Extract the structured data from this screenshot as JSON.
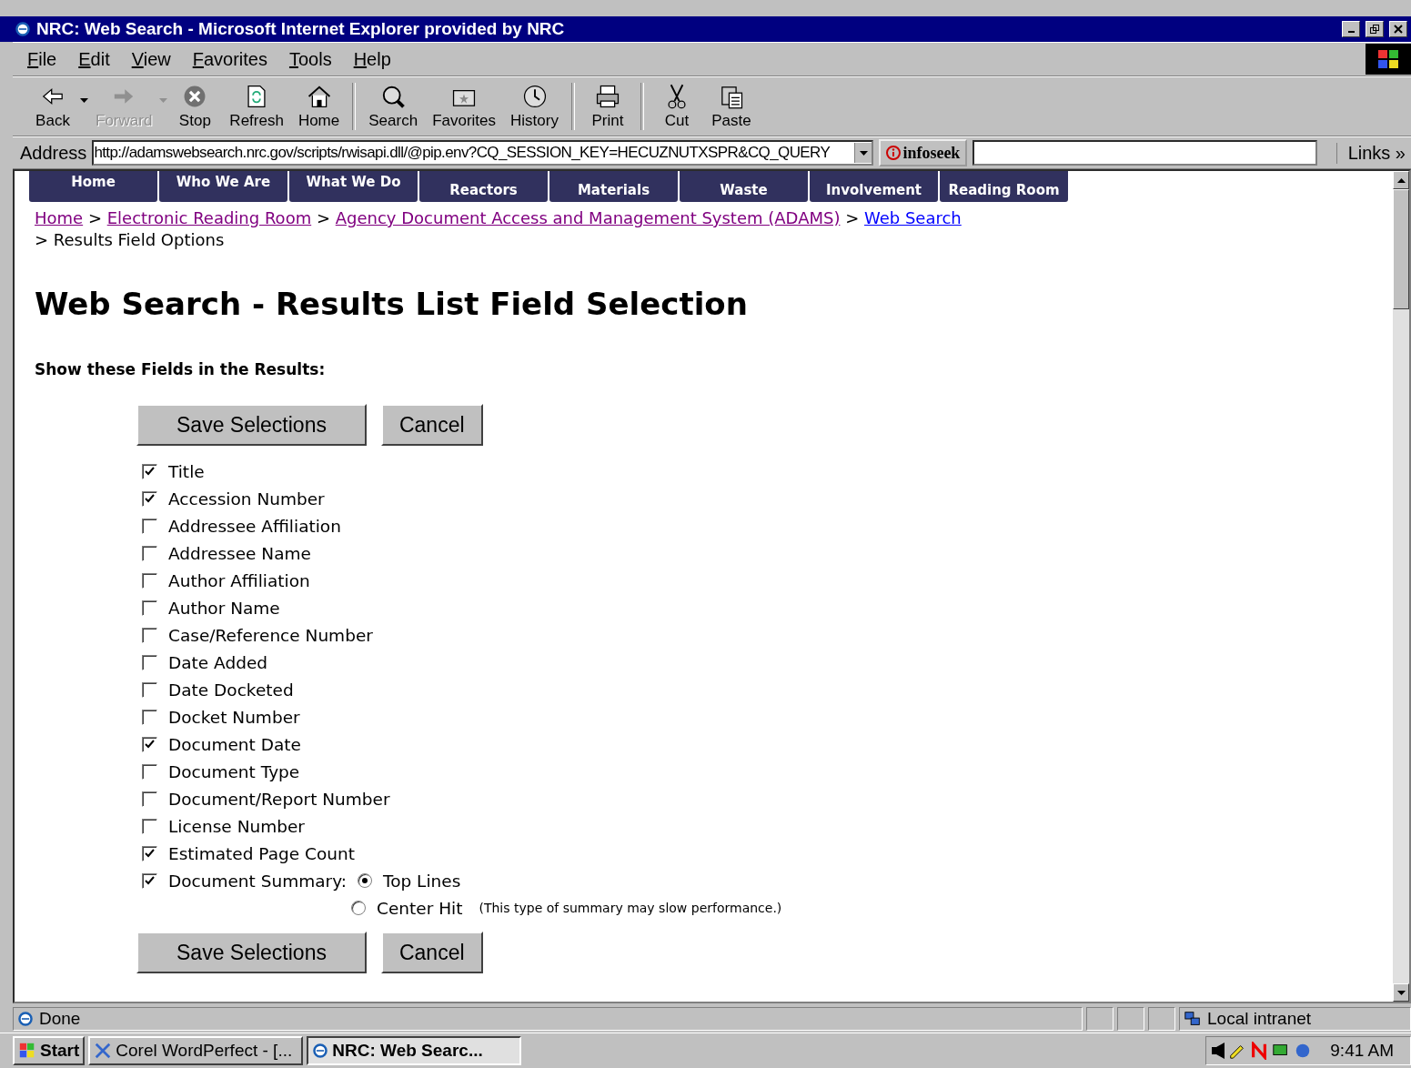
{
  "window": {
    "title": "NRC: Web Search - Microsoft Internet Explorer provided by NRC"
  },
  "menu": [
    {
      "label": "File"
    },
    {
      "label": "Edit"
    },
    {
      "label": "View"
    },
    {
      "label": "Favorites"
    },
    {
      "label": "Tools"
    },
    {
      "label": "Help"
    }
  ],
  "toolbar": [
    {
      "label": "Back",
      "kind": "back",
      "disabled": false,
      "dropdown": true,
      "separator_before": false
    },
    {
      "label": "Forward",
      "kind": "forward",
      "disabled": true,
      "dropdown": true,
      "separator_before": false
    },
    {
      "label": "Stop",
      "kind": "stop",
      "disabled": false,
      "dropdown": false,
      "separator_before": false
    },
    {
      "label": "Refresh",
      "kind": "refresh",
      "disabled": false,
      "dropdown": false,
      "separator_before": false
    },
    {
      "label": "Home",
      "kind": "home",
      "disabled": false,
      "dropdown": false,
      "separator_before": false
    },
    {
      "label": "Search",
      "kind": "search",
      "disabled": false,
      "dropdown": false,
      "separator_before": true
    },
    {
      "label": "Favorites",
      "kind": "favorites",
      "disabled": false,
      "dropdown": false,
      "separator_before": false
    },
    {
      "label": "History",
      "kind": "history",
      "disabled": false,
      "dropdown": false,
      "separator_before": false
    },
    {
      "label": "Print",
      "kind": "print",
      "disabled": false,
      "dropdown": false,
      "separator_before": true
    },
    {
      "label": "Cut",
      "kind": "cut",
      "disabled": false,
      "dropdown": false,
      "separator_before": true
    },
    {
      "label": "Paste",
      "kind": "paste",
      "disabled": false,
      "dropdown": false,
      "separator_before": false
    }
  ],
  "address": {
    "label": "Address",
    "value": "http://adamswebsearch.nrc.gov/scripts/rwisapi.dll/@pip.env?CQ_SESSION_KEY=HECUZNUTXSPR&CQ_QUERY",
    "search_button": "infoseek",
    "links": "Links »"
  },
  "nav": [
    "Home",
    "Who We Are",
    "What We Do",
    "Reactors",
    "Materials",
    "Waste",
    "Involvement",
    "Reading Room"
  ],
  "breadcrumb": [
    {
      "label": "Home",
      "visited": true
    },
    {
      "label": "Electronic Reading Room",
      "visited": true
    },
    {
      "label": "Agency Document Access and Management System (ADAMS)",
      "visited": true
    },
    {
      "label": "Web Search",
      "visited": false
    }
  ],
  "breadcrumb_current": "Results Field Options",
  "separator": ">",
  "heading": "Web Search - Results List Field Selection",
  "subheading": "Show these Fields in the Results:",
  "top_buttons": [
    "Save Selections",
    "Cancel"
  ],
  "fields": [
    {
      "label": "Title",
      "checked": true
    },
    {
      "label": "Accession Number",
      "checked": true
    },
    {
      "label": "Addressee Affiliation",
      "checked": false
    },
    {
      "label": "Addressee Name",
      "checked": false
    },
    {
      "label": "Author Affiliation",
      "checked": false
    },
    {
      "label": "Author Name",
      "checked": false
    },
    {
      "label": "Case/Reference Number",
      "checked": false
    },
    {
      "label": "Date Added",
      "checked": false
    },
    {
      "label": "Date Docketed",
      "checked": false
    },
    {
      "label": "Docket Number",
      "checked": false
    },
    {
      "label": "Document Date",
      "checked": true
    },
    {
      "label": "Document Type",
      "checked": false
    },
    {
      "label": "Document/Report Number",
      "checked": false
    },
    {
      "label": "License Number",
      "checked": false
    },
    {
      "label": "Estimated Page Count",
      "checked": true
    }
  ],
  "summary": {
    "label": "Document Summary:",
    "checked": true,
    "options": [
      {
        "label": "Top Lines",
        "selected": true
      },
      {
        "label": "Center Hit",
        "selected": false,
        "note": "(This type of summary may slow performance.)"
      }
    ]
  },
  "bottom_buttons": [
    "Save Selections",
    "Cancel"
  ],
  "status_bar": {
    "text": "Done",
    "zone": "Local intranet"
  },
  "taskbar": {
    "start": "Start",
    "tasks": [
      {
        "label": "Corel WordPerfect - [...",
        "selected": false
      },
      {
        "label": "NRC: Web Searc...",
        "selected": true
      }
    ],
    "clock": "9:41 AM"
  }
}
